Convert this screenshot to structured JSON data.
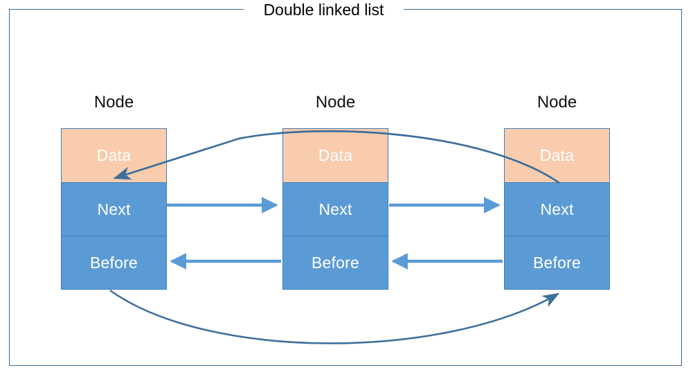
{
  "diagram": {
    "title": "Double linked list",
    "frame": {
      "border_color": "#356a95"
    },
    "colors": {
      "data_fill": "#F8CCAC",
      "pointer_fill": "#5B9BD5",
      "box_border": "#3f7eb8",
      "straight_arrow": "#5B9BD5",
      "curved_arrow": "#3c6f9c",
      "cell_text": "#FFFFFF",
      "label_text": "#111111"
    },
    "nodes": [
      {
        "label": "Node",
        "cells": [
          {
            "name": "data",
            "text": "Data"
          },
          {
            "name": "next",
            "text": "Next"
          },
          {
            "name": "before",
            "text": "Before"
          }
        ]
      },
      {
        "label": "Node",
        "cells": [
          {
            "name": "data",
            "text": "Data"
          },
          {
            "name": "next",
            "text": "Next"
          },
          {
            "name": "before",
            "text": "Before"
          }
        ]
      },
      {
        "label": "Node",
        "cells": [
          {
            "name": "data",
            "text": "Data"
          },
          {
            "name": "next",
            "text": "Next"
          },
          {
            "name": "before",
            "text": "Before"
          }
        ]
      }
    ],
    "connectors": [
      {
        "name": "next-1-to-2",
        "from": "node1.next",
        "to": "node2.next",
        "direction": "right",
        "style": "straight",
        "color": "#5B9BD5"
      },
      {
        "name": "next-2-to-3",
        "from": "node2.next",
        "to": "node3.next",
        "direction": "right",
        "style": "straight",
        "color": "#5B9BD5"
      },
      {
        "name": "before-2-to-1",
        "from": "node2.before",
        "to": "node1.before",
        "direction": "left",
        "style": "straight",
        "color": "#5B9BD5"
      },
      {
        "name": "before-3-to-2",
        "from": "node3.before",
        "to": "node2.before",
        "direction": "left",
        "style": "straight",
        "color": "#5B9BD5"
      },
      {
        "name": "wrap-top-3-to-1",
        "from": "node3.data",
        "to": "node1.data",
        "direction": "left",
        "style": "curved-over",
        "color": "#3c6f9c"
      },
      {
        "name": "wrap-bottom-1-to-3",
        "from": "node1.before",
        "to": "node3.before",
        "direction": "right",
        "style": "curved-under",
        "color": "#3c6f9c"
      }
    ]
  }
}
